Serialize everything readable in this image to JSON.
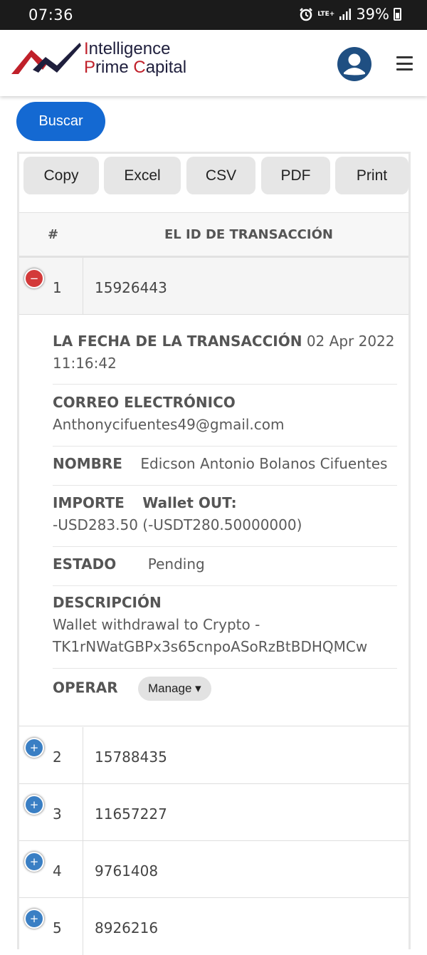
{
  "status_bar": {
    "time": "07:36",
    "network": "LTE+",
    "battery": "39%"
  },
  "header": {
    "logo_line1": "Intelligence",
    "logo_line2": "Prime Capital"
  },
  "search": {
    "button_label": "Buscar"
  },
  "toolbar": {
    "buttons": [
      "Copy",
      "Excel",
      "CSV",
      "PDF",
      "Print"
    ]
  },
  "table": {
    "columns": [
      "#",
      "EL ID DE TRANSACCIÓN"
    ],
    "rows": [
      {
        "index": "1",
        "transaction_id": "15926443",
        "expanded": true
      },
      {
        "index": "2",
        "transaction_id": "15788435",
        "expanded": false
      },
      {
        "index": "3",
        "transaction_id": "11657227",
        "expanded": false
      },
      {
        "index": "4",
        "transaction_id": "9761408",
        "expanded": false
      },
      {
        "index": "5",
        "transaction_id": "8926216",
        "expanded": false
      }
    ]
  },
  "detail": {
    "date_label": "LA FECHA DE LA TRANSACCIÓN",
    "date_value": "02 Apr 2022 11:16:42",
    "email_label": "CORREO ELECTRÓNICO",
    "email_value": "Anthonycifuentes49@gmail.com",
    "name_label": "NOMBRE",
    "name_value": "Edicson Antonio Bolanos Cifuentes",
    "amount_label": "IMPORTE",
    "amount_value_part1": "Wallet OUT:",
    "amount_value_part2": "-USD283.50 (-USDT280.50000000)",
    "status_label": "ESTADO",
    "status_value": "Pending",
    "description_label": "DESCRIPCIÓN",
    "description_value": "Wallet withdrawal to Crypto - TK1rNWatGBPx3s65cnpoASoRzBtBDHQMCw",
    "operate_label": "OPERAR",
    "manage_label": "Manage"
  },
  "colors": {
    "primary": "#1469d2",
    "logo_red": "#c0202a",
    "logo_navy": "#1f1f3d",
    "collapse": "#d33a3a",
    "expand": "#3a7fc4"
  }
}
